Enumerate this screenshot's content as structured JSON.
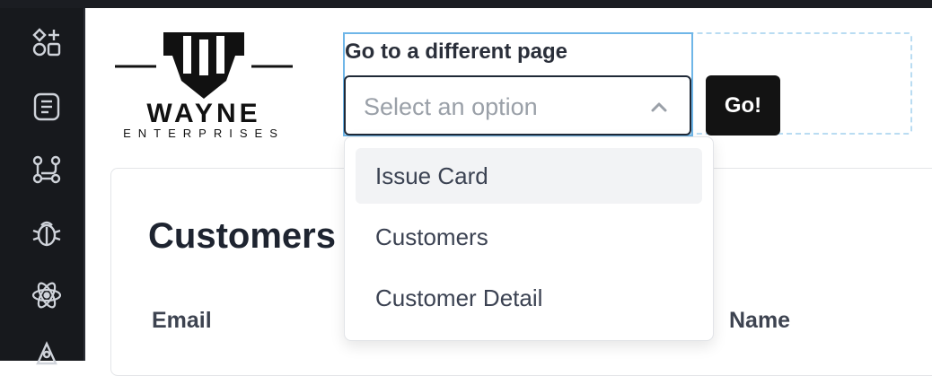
{
  "sidebar": {
    "icons": [
      "shapes-icon",
      "document-icon",
      "git-branch-icon",
      "bug-icon",
      "react-atom-icon",
      "rocket-icon"
    ]
  },
  "logo": {
    "word": "WAYNE",
    "sub": "ENTERPRISES"
  },
  "page_selector": {
    "label": "Go to a different page",
    "placeholder": "Select an option",
    "go_label": "Go!",
    "options": [
      "Issue Card",
      "Customers",
      "Customer Detail"
    ]
  },
  "card": {
    "title": "Customers",
    "columns": [
      "Email",
      "Name"
    ]
  }
}
